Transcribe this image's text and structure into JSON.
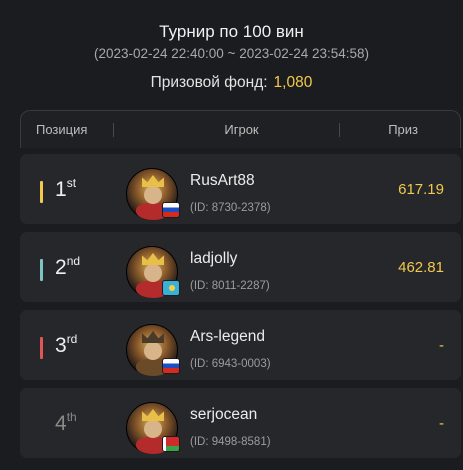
{
  "tournament": {
    "title": "Турнир по 100 вин",
    "date_range": "(2023-02-24 22:40:00 ~ 2023-02-24 23:54:58)",
    "prize_fund_label": "Призовой фонд:",
    "prize_fund_value": "1,080"
  },
  "table": {
    "headers": {
      "position": "Позиция",
      "player": "Игрок",
      "prize": "Приз"
    },
    "rows": [
      {
        "place_num": "1",
        "place_suffix": "st",
        "marker_color": "#f2c94c",
        "name": "RusArt88",
        "id": "(ID: 8730-2378)",
        "flag": "russia-flag-icon",
        "prize": "617.19"
      },
      {
        "place_num": "2",
        "place_suffix": "nd",
        "marker_color": "#7fc4c4",
        "name": "ladjolly",
        "id": "(ID: 8011-2287)",
        "flag": "kazakhstan-flag-icon",
        "prize": "462.81"
      },
      {
        "place_num": "3",
        "place_suffix": "rd",
        "marker_color": "#e05555",
        "name": "Ars-legend",
        "id": "(ID: 6943-0003)",
        "flag": "russia-flag-icon",
        "prize": "-"
      },
      {
        "place_num": "4",
        "place_suffix": "th",
        "marker_color": "",
        "name": "serjocean",
        "id": "(ID: 9498-8581)",
        "flag": "belarus-flag-icon",
        "prize": "-"
      }
    ]
  },
  "colors": {
    "background": "#1b1c1f",
    "row": "#26272b",
    "accent_gold": "#f2c94c"
  }
}
